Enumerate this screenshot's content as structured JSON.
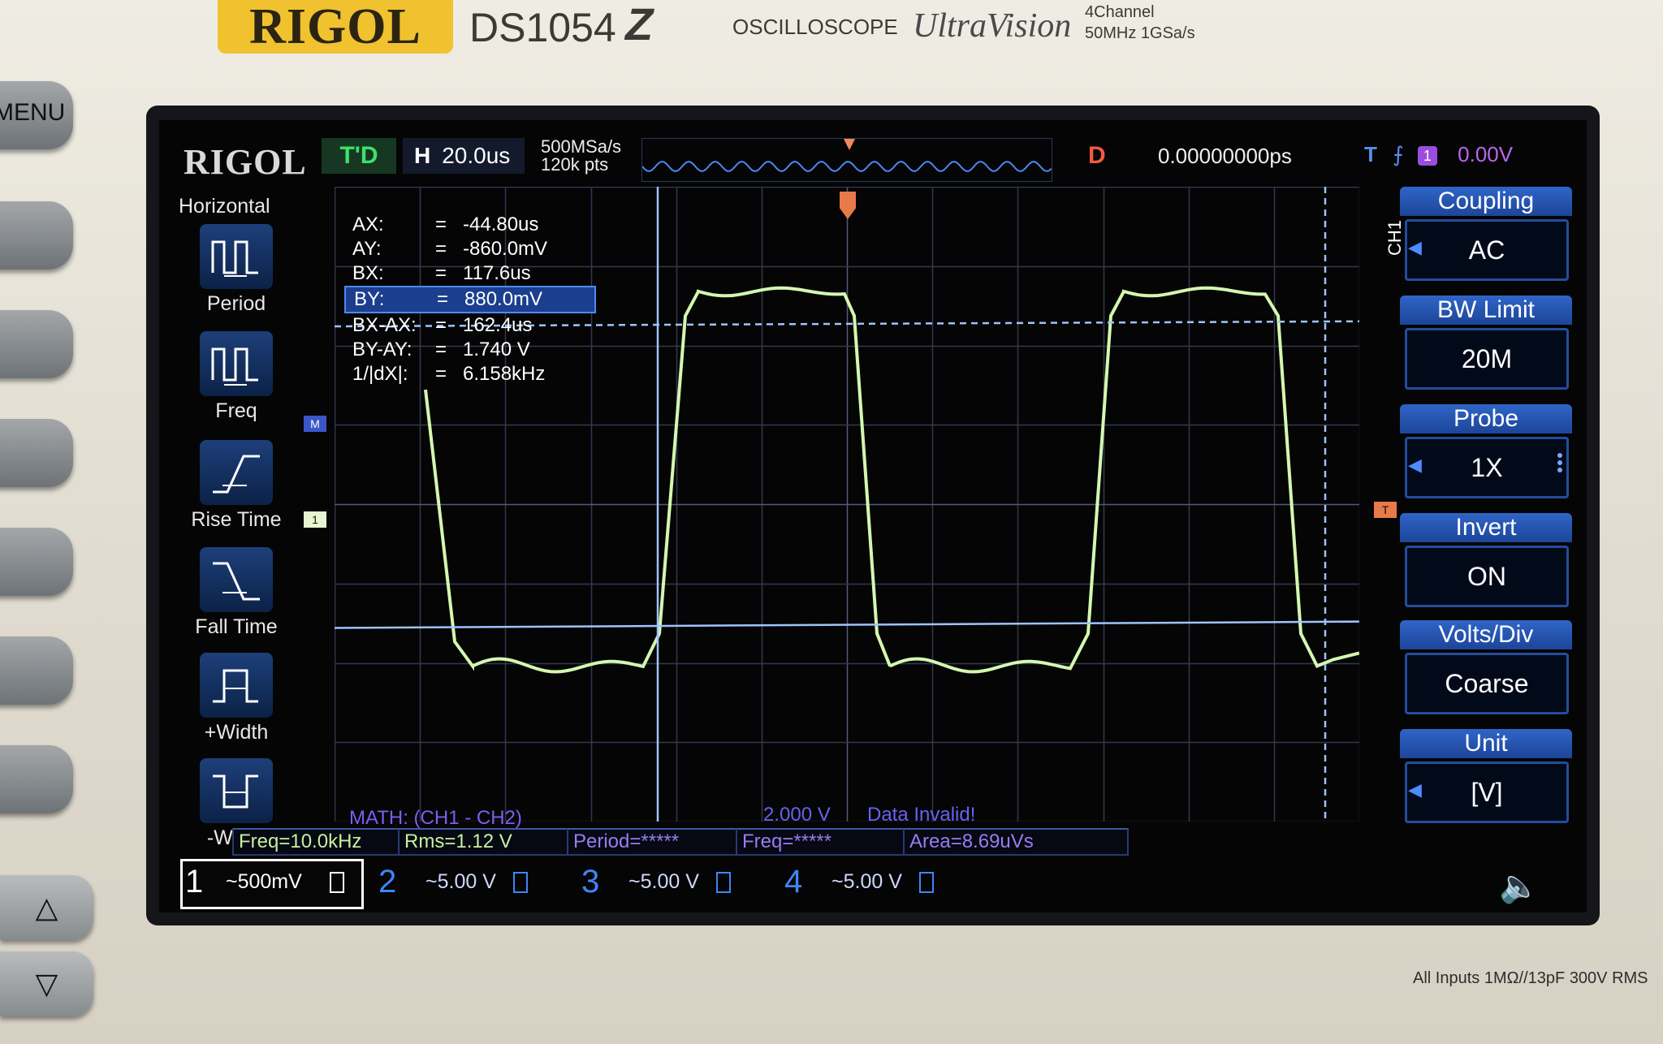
{
  "bezel": {
    "brand": "RIGOL",
    "model": "DS1054",
    "model_suffix": "Z",
    "product": "OSCILLOSCOPE",
    "series": "UltraVision",
    "spec_line1": "4Channel",
    "spec_line2": "50MHz 1GSa/s",
    "menu_label": "MENU",
    "inputs_note": "All Inputs 1MΩ//13pF 300V RMS"
  },
  "header": {
    "logo": "RIGOL",
    "trigger_status": "T'D",
    "h_label": "H",
    "timebase": "20.0us",
    "sample_rate": "500MSa/s",
    "points": "120k pts",
    "d_label": "D",
    "delay": "0.00000000ps",
    "trigger_label": "T",
    "trigger_level": "0.00V"
  },
  "left_menu": {
    "title": "Horizontal",
    "items": [
      {
        "label": "Period",
        "icon": "period-icon"
      },
      {
        "label": "Freq",
        "icon": "freq-icon"
      },
      {
        "label": "Rise Time",
        "icon": "rise-time-icon"
      },
      {
        "label": "Fall Time",
        "icon": "fall-time-icon"
      },
      {
        "label": "+Width",
        "icon": "positive-width-icon"
      },
      {
        "label": "-Width",
        "icon": "negative-width-icon"
      }
    ]
  },
  "cursors": [
    {
      "key": "AX:",
      "value": "-44.80us"
    },
    {
      "key": "AY:",
      "value": "-860.0mV"
    },
    {
      "key": "BX:",
      "value": "117.6us"
    },
    {
      "key": "BY:",
      "value": "880.0mV",
      "selected": true
    },
    {
      "key": "BX-AX:",
      "value": "162.4us"
    },
    {
      "key": "BY-AY:",
      "value": "1.740 V"
    },
    {
      "key": "1/|dX|:",
      "value": "6.158kHz"
    }
  ],
  "right_menu": {
    "channel": "CH1",
    "items": [
      {
        "title": "Coupling",
        "value": "AC",
        "arrow": true
      },
      {
        "title": "BW Limit",
        "value": "20M",
        "arrow": false
      },
      {
        "title": "Probe",
        "value": "1X",
        "arrow": true
      },
      {
        "title": "Invert",
        "value": "ON",
        "arrow": false
      },
      {
        "title": "Volts/Div",
        "value": "Coarse",
        "arrow": false
      },
      {
        "title": "Unit",
        "value": "[V]",
        "arrow": true
      }
    ]
  },
  "display": {
    "math_label": "MATH: (CH1 - CH2)",
    "math_scale": "2.000 V",
    "status": "Data Invalid!",
    "marker_m": "M",
    "marker_1": "1",
    "marker_t": "T"
  },
  "measurements": [
    {
      "text": "Freq=10.0kHz",
      "color": "#c8f0a0"
    },
    {
      "text": "Rms=1.12 V",
      "color": "#c8f0a0"
    },
    {
      "text": "Period=*****",
      "color": "#9a7cf0"
    },
    {
      "text": "Freq=*****",
      "color": "#9a7cf0"
    },
    {
      "text": "Area=8.69uVs",
      "color": "#9a7cf0"
    }
  ],
  "channels": [
    {
      "num": "1",
      "scale": "~500mV",
      "color": "#d8f5b8"
    },
    {
      "num": "2",
      "scale": "~5.00 V",
      "color": "#3e86f5"
    },
    {
      "num": "3",
      "scale": "~5.00 V",
      "color": "#3e86f5"
    },
    {
      "num": "4",
      "scale": "~5.00 V",
      "color": "#3e86f5"
    }
  ],
  "colors": {
    "ch1_trace": "#d4f7b0",
    "cursor": "#9fc3ff",
    "grid": "#3a3d55",
    "accent": "#2f65c8"
  }
}
